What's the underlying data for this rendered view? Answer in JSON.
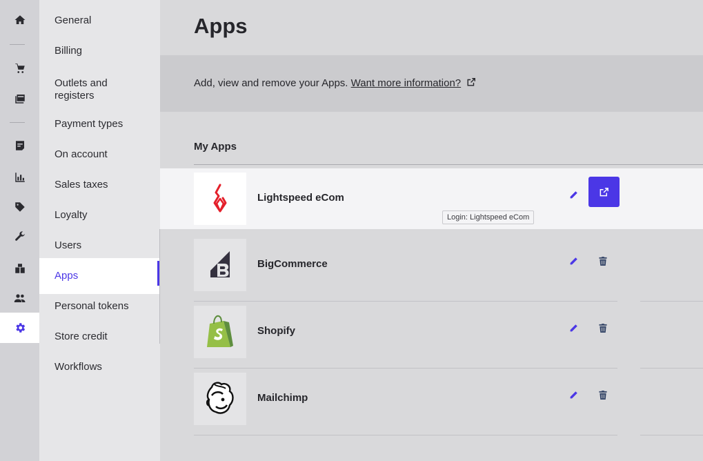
{
  "rail": {
    "icons": [
      "home-icon",
      "cart-icon",
      "catalog-icon",
      "sales-ledger-icon",
      "reports-icon",
      "promotions-icon",
      "setup-icon",
      "inventory-icon",
      "customers-icon",
      "settings-icon"
    ]
  },
  "subnav": {
    "items": [
      {
        "label": "General"
      },
      {
        "label": "Billing"
      },
      {
        "label": "Outlets and registers"
      },
      {
        "label": "Payment types"
      },
      {
        "label": "On account"
      },
      {
        "label": "Sales taxes"
      },
      {
        "label": "Loyalty"
      },
      {
        "label": "Users"
      },
      {
        "label": "Apps",
        "active": true
      },
      {
        "label": "Personal tokens"
      },
      {
        "label": "Store credit"
      },
      {
        "label": "Workflows"
      }
    ]
  },
  "page": {
    "title": "Apps",
    "info_text": "Add, view and remove your Apps.",
    "info_link": "Want more information?",
    "section_title": "My Apps"
  },
  "apps": [
    {
      "name": "Lightspeed eCom",
      "logo": "lightspeed-logo",
      "action": "login"
    },
    {
      "name": "BigCommerce",
      "logo": "bigcommerce-logo",
      "action": "delete"
    },
    {
      "name": "Shopify",
      "logo": "shopify-logo",
      "action": "delete"
    },
    {
      "name": "Mailchimp",
      "logo": "mailchimp-logo",
      "action": "delete"
    }
  ],
  "tooltip": {
    "text": "Login: Lightspeed eCom"
  },
  "colors": {
    "accent": "#4b37e6",
    "lightspeed_red": "#e4202b",
    "shopify_green": "#95bf47"
  }
}
